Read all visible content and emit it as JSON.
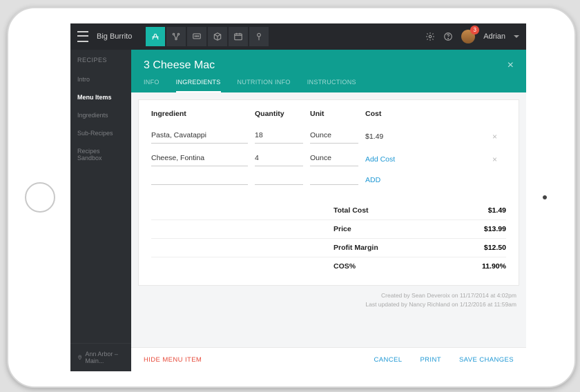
{
  "header": {
    "app_name": "Big Burrito",
    "username": "Adrian",
    "badge_count": "3"
  },
  "sidebar": {
    "title": "RECIPES",
    "items": [
      {
        "label": "Intro"
      },
      {
        "label": "Menu Items"
      },
      {
        "label": "Ingredients"
      },
      {
        "label": "Sub-Recipes"
      },
      {
        "label": "Recipes Sandbox"
      }
    ],
    "footer": "Ann Arbor – Main..."
  },
  "panel": {
    "title": "3 Cheese Mac",
    "tabs": [
      {
        "label": "INFO"
      },
      {
        "label": "INGREDIENTS"
      },
      {
        "label": "NUTRITION INFO"
      },
      {
        "label": "INSTRUCTIONS"
      }
    ]
  },
  "table": {
    "columns": {
      "c1": "Ingredient",
      "c2": "Quantity",
      "c3": "Unit",
      "c4": "Cost"
    },
    "rows": [
      {
        "ingredient": "Pasta, Cavatappi",
        "quantity": "18",
        "unit": "Ounce",
        "cost": "$1.49"
      },
      {
        "ingredient": "Cheese, Fontina",
        "quantity": "4",
        "unit": "Ounce",
        "cost_link": "Add Cost"
      }
    ],
    "add_label": "ADD"
  },
  "summary": {
    "rows": [
      {
        "label": "Total Cost",
        "val": "$1.49"
      },
      {
        "label": "Price",
        "val": "$13.99"
      },
      {
        "label": "Profit Margin",
        "val": "$12.50"
      },
      {
        "label": "COS%",
        "val": "11.90%"
      }
    ]
  },
  "meta": {
    "line1": "Created by Sean Deveroix on 11/17/2014 at 4:02pm",
    "line2": "Last updated by Nancy Richland on 1/12/2016 at 11:59am"
  },
  "footer": {
    "hide": "HIDE MENU ITEM",
    "cancel": "CANCEL",
    "print": "PRINT",
    "save": "SAVE CHANGES"
  }
}
